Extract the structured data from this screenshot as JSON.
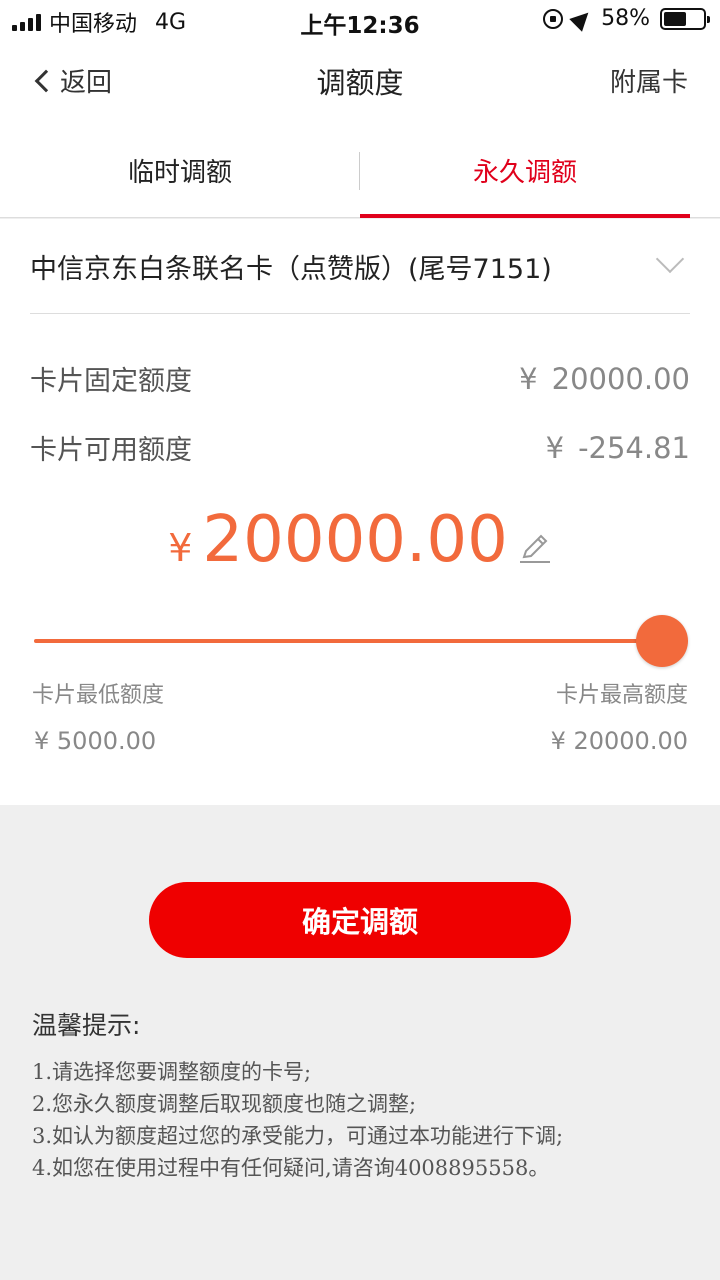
{
  "status_bar": {
    "carrier": "中国移动",
    "network": "4G",
    "time": "上午12:36",
    "battery": "58%",
    "battery_level": 0.58
  },
  "nav": {
    "back_label": "返回",
    "title": "调额度",
    "right_label": "附属卡"
  },
  "tabs": [
    {
      "label": "临时调额",
      "active": false
    },
    {
      "label": "永久调额",
      "active": true
    }
  ],
  "card": {
    "name": "中信京东白条联名卡（点赞版）(尾号7151)"
  },
  "limits": {
    "fixed_label": "卡片固定额度",
    "fixed_yen": "¥",
    "fixed_value": "20000.00",
    "available_label": "卡片可用额度",
    "available_yen": "¥",
    "available_value": "-254.81"
  },
  "adjust": {
    "yen": "¥",
    "amount": "20000.00",
    "slider_fraction": 1.0,
    "min_label": "卡片最低额度",
    "min_value": "¥  5000.00",
    "max_label": "卡片最高额度",
    "max_value": "¥  20000.00"
  },
  "confirm_label": "确定调额",
  "tips": {
    "title": "温馨提示:",
    "items": [
      "1.请选择您要调整额度的卡号;",
      "2.您永久额度调整后取现额度也随之调整;",
      "3.如认为额度超过您的承受能力，可通过本功能进行下调;",
      "4.如您在使用过程中有任何疑问,请咨询4008895558。"
    ]
  },
  "colors": {
    "accent_red": "#e0001b",
    "amount_orange": "#f26a3c",
    "button_red": "#ef0000"
  }
}
